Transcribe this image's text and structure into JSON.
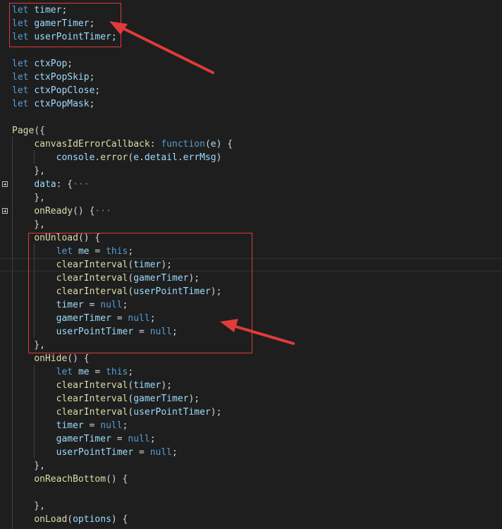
{
  "theme": {
    "background": "#1e1e1e",
    "keyword": "#569cd6",
    "variable": "#9cdcfe",
    "function": "#dcdcaa",
    "plain": "#d4d4d4",
    "fold_ellipsis": "#808080",
    "annotation": "#e03a3a"
  },
  "icons": {
    "fold": "expand-plus-icon",
    "annotation_arrow": "arrow-icon"
  },
  "lines": [
    [
      {
        "t": "let",
        "c": "kw"
      },
      {
        "t": " "
      },
      {
        "t": "timer",
        "c": "var"
      },
      {
        "t": ";"
      }
    ],
    [
      {
        "t": "let",
        "c": "kw"
      },
      {
        "t": " "
      },
      {
        "t": "gamerTimer",
        "c": "var"
      },
      {
        "t": ";"
      }
    ],
    [
      {
        "t": "let",
        "c": "kw"
      },
      {
        "t": " "
      },
      {
        "t": "userPointTimer",
        "c": "var"
      },
      {
        "t": ";"
      }
    ],
    [],
    [
      {
        "t": "let",
        "c": "kw"
      },
      {
        "t": " "
      },
      {
        "t": "ctxPop",
        "c": "var"
      },
      {
        "t": ";"
      }
    ],
    [
      {
        "t": "let",
        "c": "kw"
      },
      {
        "t": " "
      },
      {
        "t": "ctxPopSkip",
        "c": "var"
      },
      {
        "t": ";"
      }
    ],
    [
      {
        "t": "let",
        "c": "kw"
      },
      {
        "t": " "
      },
      {
        "t": "ctxPopClose",
        "c": "var"
      },
      {
        "t": ";"
      }
    ],
    [
      {
        "t": "let",
        "c": "kw"
      },
      {
        "t": " "
      },
      {
        "t": "ctxPopMask",
        "c": "var"
      },
      {
        "t": ";"
      }
    ],
    [],
    [
      {
        "t": "Page",
        "c": "fn"
      },
      {
        "t": "({"
      }
    ],
    [
      {
        "t": "    "
      },
      {
        "t": "canvasIdErrorCallback",
        "c": "fn"
      },
      {
        "t": ": "
      },
      {
        "t": "function",
        "c": "kw"
      },
      {
        "t": "("
      },
      {
        "t": "e",
        "c": "var"
      },
      {
        "t": ") {"
      }
    ],
    [
      {
        "t": "        "
      },
      {
        "t": "console",
        "c": "var"
      },
      {
        "t": "."
      },
      {
        "t": "error",
        "c": "fn"
      },
      {
        "t": "("
      },
      {
        "t": "e",
        "c": "var"
      },
      {
        "t": "."
      },
      {
        "t": "detail",
        "c": "var"
      },
      {
        "t": "."
      },
      {
        "t": "errMsg",
        "c": "var"
      },
      {
        "t": ")"
      }
    ],
    [
      {
        "t": "    },"
      }
    ],
    [
      {
        "t": "    "
      },
      {
        "t": "data",
        "c": "var"
      },
      {
        "t": ": {"
      },
      {
        "t": "···",
        "c": "fold"
      }
    ],
    [
      {
        "t": "    },"
      }
    ],
    [
      {
        "t": "    "
      },
      {
        "t": "onReady",
        "c": "fn"
      },
      {
        "t": "() {"
      },
      {
        "t": "···",
        "c": "fold"
      }
    ],
    [
      {
        "t": "    },"
      }
    ],
    [
      {
        "t": "    "
      },
      {
        "t": "onUnload",
        "c": "fn"
      },
      {
        "t": "() {"
      }
    ],
    [
      {
        "t": "        "
      },
      {
        "t": "let",
        "c": "kw"
      },
      {
        "t": " "
      },
      {
        "t": "me",
        "c": "var"
      },
      {
        "t": " = "
      },
      {
        "t": "this",
        "c": "kw"
      },
      {
        "t": ";"
      }
    ],
    [
      {
        "t": "        "
      },
      {
        "t": "clearInterval",
        "c": "fn"
      },
      {
        "t": "("
      },
      {
        "t": "timer",
        "c": "var"
      },
      {
        "t": ");"
      }
    ],
    [
      {
        "t": "        "
      },
      {
        "t": "clearInterval",
        "c": "fn"
      },
      {
        "t": "("
      },
      {
        "t": "gamerTimer",
        "c": "var"
      },
      {
        "t": ");"
      }
    ],
    [
      {
        "t": "        "
      },
      {
        "t": "clearInterval",
        "c": "fn"
      },
      {
        "t": "("
      },
      {
        "t": "userPointTimer",
        "c": "var"
      },
      {
        "t": ");"
      }
    ],
    [
      {
        "t": "        "
      },
      {
        "t": "timer",
        "c": "var"
      },
      {
        "t": " = "
      },
      {
        "t": "null",
        "c": "kw"
      },
      {
        "t": ";"
      }
    ],
    [
      {
        "t": "        "
      },
      {
        "t": "gamerTimer",
        "c": "var"
      },
      {
        "t": " = "
      },
      {
        "t": "null",
        "c": "kw"
      },
      {
        "t": ";"
      }
    ],
    [
      {
        "t": "        "
      },
      {
        "t": "userPointTimer",
        "c": "var"
      },
      {
        "t": " = "
      },
      {
        "t": "null",
        "c": "kw"
      },
      {
        "t": ";"
      }
    ],
    [
      {
        "t": "    },"
      }
    ],
    [
      {
        "t": "    "
      },
      {
        "t": "onHide",
        "c": "fn"
      },
      {
        "t": "() {"
      }
    ],
    [
      {
        "t": "        "
      },
      {
        "t": "let",
        "c": "kw"
      },
      {
        "t": " "
      },
      {
        "t": "me",
        "c": "var"
      },
      {
        "t": " = "
      },
      {
        "t": "this",
        "c": "kw"
      },
      {
        "t": ";"
      }
    ],
    [
      {
        "t": "        "
      },
      {
        "t": "clearInterval",
        "c": "fn"
      },
      {
        "t": "("
      },
      {
        "t": "timer",
        "c": "var"
      },
      {
        "t": ");"
      }
    ],
    [
      {
        "t": "        "
      },
      {
        "t": "clearInterval",
        "c": "fn"
      },
      {
        "t": "("
      },
      {
        "t": "gamerTimer",
        "c": "var"
      },
      {
        "t": ");"
      }
    ],
    [
      {
        "t": "        "
      },
      {
        "t": "clearInterval",
        "c": "fn"
      },
      {
        "t": "("
      },
      {
        "t": "userPointTimer",
        "c": "var"
      },
      {
        "t": ");"
      }
    ],
    [
      {
        "t": "        "
      },
      {
        "t": "timer",
        "c": "var"
      },
      {
        "t": " = "
      },
      {
        "t": "null",
        "c": "kw"
      },
      {
        "t": ";"
      }
    ],
    [
      {
        "t": "        "
      },
      {
        "t": "gamerTimer",
        "c": "var"
      },
      {
        "t": " = "
      },
      {
        "t": "null",
        "c": "kw"
      },
      {
        "t": ";"
      }
    ],
    [
      {
        "t": "        "
      },
      {
        "t": "userPointTimer",
        "c": "var"
      },
      {
        "t": " = "
      },
      {
        "t": "null",
        "c": "kw"
      },
      {
        "t": ";"
      }
    ],
    [
      {
        "t": "    },"
      }
    ],
    [
      {
        "t": "    "
      },
      {
        "t": "onReachBottom",
        "c": "fn"
      },
      {
        "t": "() {"
      }
    ],
    [],
    [
      {
        "t": "    },"
      }
    ],
    [
      {
        "t": "    "
      },
      {
        "t": "onLoad",
        "c": "fn"
      },
      {
        "t": "("
      },
      {
        "t": "options",
        "c": "var"
      },
      {
        "t": ") {"
      }
    ]
  ]
}
